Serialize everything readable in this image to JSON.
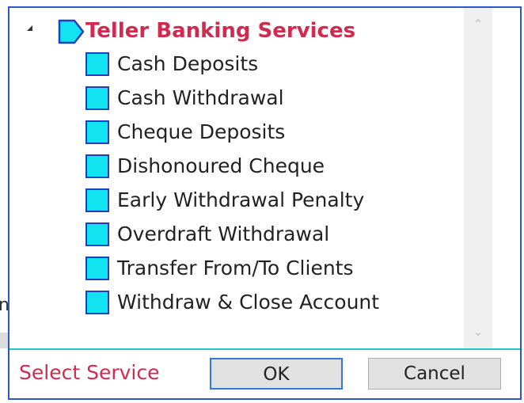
{
  "background": {
    "partial_glyph": "n"
  },
  "tree": {
    "root": {
      "label": "Teller Banking Services",
      "icon": "folder-tag-icon",
      "expanded": true
    },
    "items": [
      {
        "label": "Cash Deposits",
        "icon": "service-square-icon"
      },
      {
        "label": "Cash Withdrawal",
        "icon": "service-square-icon"
      },
      {
        "label": "Cheque Deposits",
        "icon": "service-square-icon"
      },
      {
        "label": "Dishonoured Cheque",
        "icon": "service-square-icon"
      },
      {
        "label": "Early Withdrawal Penalty",
        "icon": "service-square-icon"
      },
      {
        "label": "Overdraft Withdrawal",
        "icon": "service-square-icon"
      },
      {
        "label": "Transfer From/To Clients",
        "icon": "service-square-icon"
      },
      {
        "label": "Withdraw & Close Account",
        "icon": "service-square-icon"
      }
    ]
  },
  "footer": {
    "status_label": "Select Service",
    "ok_label": "OK",
    "cancel_label": "Cancel"
  },
  "colors": {
    "dialog_border": "#2d55c9",
    "accent_red": "#d02a4f",
    "icon_fill": "#12e3f0",
    "icon_border": "#1f3fbf",
    "separator": "#22c3c8",
    "ok_border": "#2f7ad9"
  }
}
